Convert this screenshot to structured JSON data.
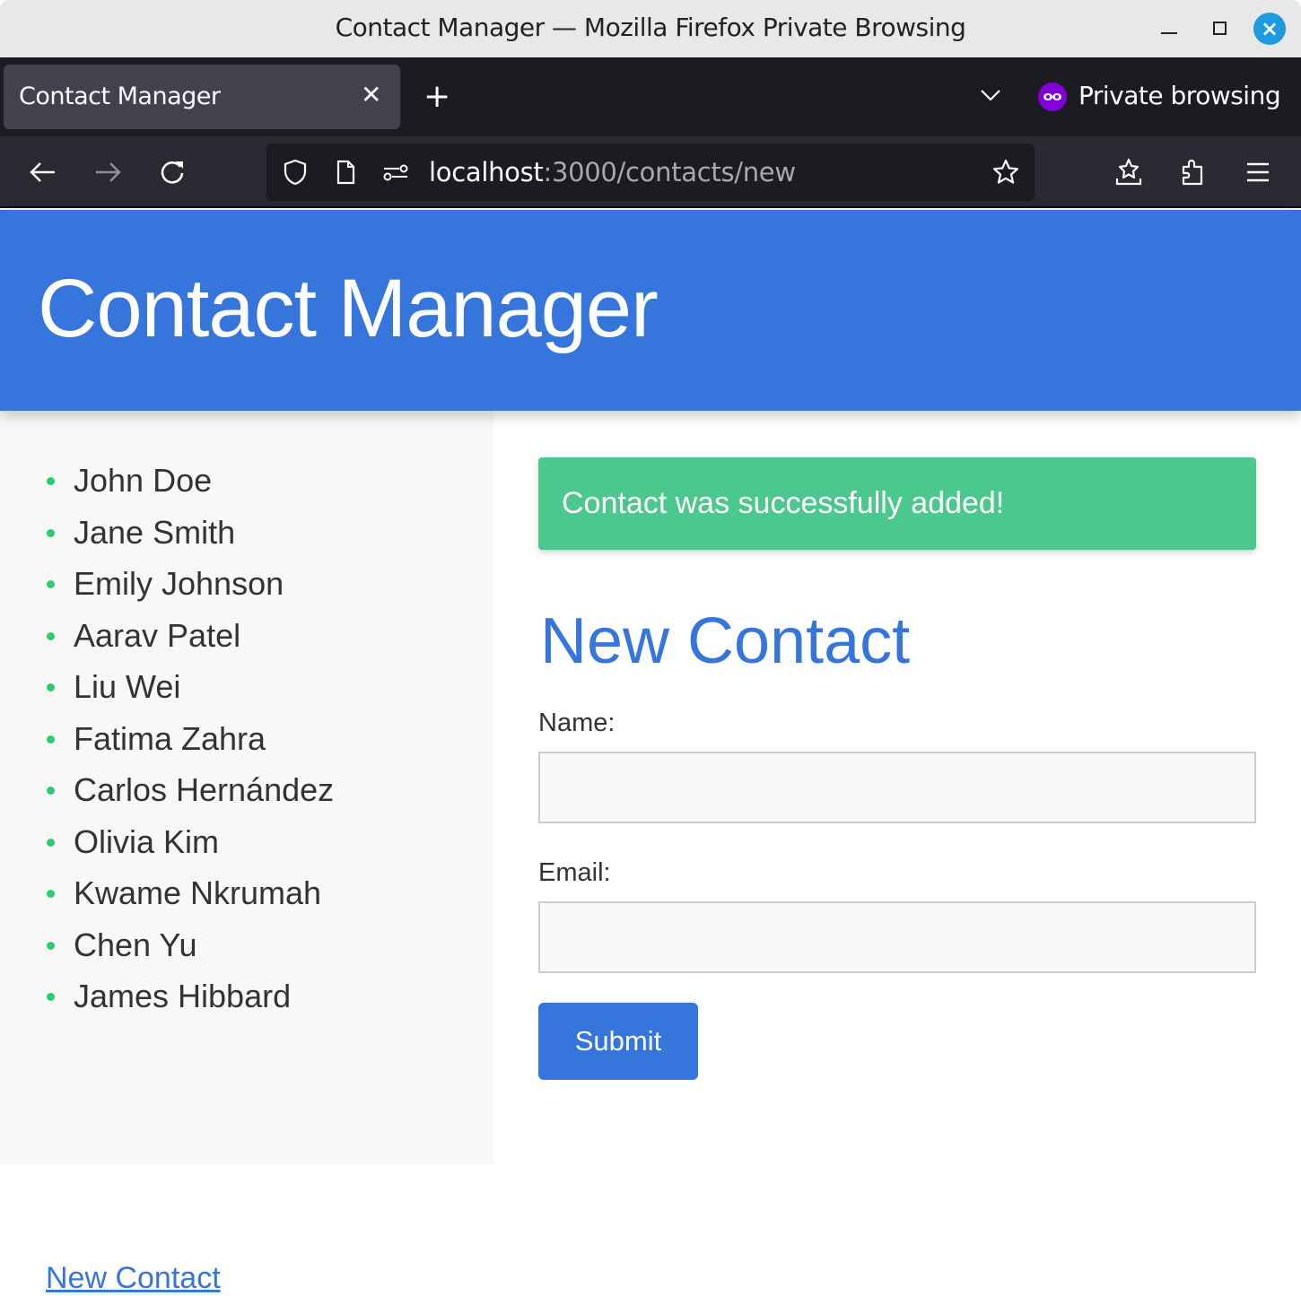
{
  "window": {
    "title": "Contact Manager — Mozilla Firefox Private Browsing"
  },
  "browser": {
    "tab_label": "Contact Manager",
    "private_label": "Private browsing",
    "url_host": "localhost",
    "url_rest": ":3000/contacts/new",
    "icons": {
      "back": "arrow-left-icon",
      "forward": "arrow-right-icon",
      "reload": "reload-icon",
      "shield": "shield-icon",
      "page": "page-icon",
      "permissions": "permissions-icon",
      "bookmark": "star-icon",
      "save_to_pocket": "pocket-icon",
      "extensions": "puzzle-icon",
      "menu": "hamburger-icon"
    }
  },
  "header": {
    "title": "Contact Manager"
  },
  "sidebar": {
    "contacts": [
      "John Doe",
      "Jane Smith",
      "Emily Johnson",
      "Aarav Patel",
      "Liu Wei",
      "Fatima Zahra",
      "Carlos Hernández",
      "Olivia Kim",
      "Kwame Nkrumah",
      "Chen Yu",
      "James Hibbard"
    ],
    "new_contact_link": "New Contact"
  },
  "main": {
    "flash_message": "Contact was successfully added!",
    "form_title": "New Contact",
    "name_label": "Name:",
    "name_value": "",
    "email_label": "Email:",
    "email_value": "",
    "submit_label": "Submit"
  },
  "colors": {
    "brand": "#3575dc",
    "success": "#4bc88d",
    "bullet": "#2ecc71"
  }
}
